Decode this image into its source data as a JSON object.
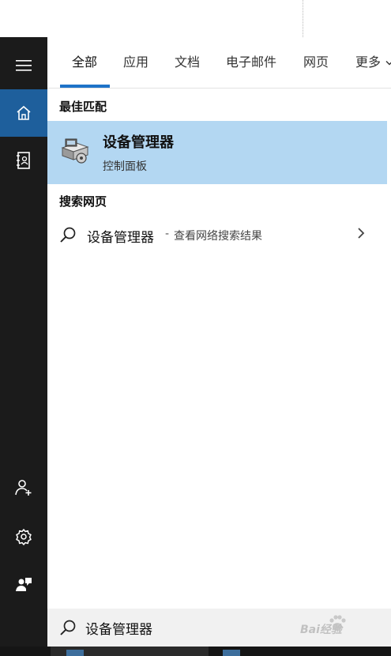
{
  "tabs": [
    {
      "label": "全部",
      "active": true
    },
    {
      "label": "应用"
    },
    {
      "label": "文档"
    },
    {
      "label": "电子邮件"
    },
    {
      "label": "网页"
    },
    {
      "label": "更多"
    }
  ],
  "sections": {
    "best_match_title": "最佳匹配",
    "web_search_title": "搜索网页"
  },
  "best_match": {
    "title": "设备管理器",
    "subtitle": "控制面板",
    "icon": "device-manager-icon"
  },
  "web_result": {
    "query": "设备管理器",
    "separator": "-",
    "hint": "查看网络搜索结果"
  },
  "sidebar": {
    "items": [
      {
        "icon": "hamburger-menu-icon"
      },
      {
        "icon": "home-icon",
        "active": true
      },
      {
        "icon": "notebook-icon"
      },
      {
        "icon": "add-person-icon"
      },
      {
        "icon": "gear-icon"
      },
      {
        "icon": "feedback-icon"
      }
    ]
  },
  "search": {
    "value": "设备管理器"
  },
  "watermark": {
    "text": "Bai经验"
  },
  "colors": {
    "sidebar_bg": "#1b1b1b",
    "sidebar_active": "#1e5f9c",
    "accent": "#1e73c8",
    "selection": "#b3d7f2"
  }
}
